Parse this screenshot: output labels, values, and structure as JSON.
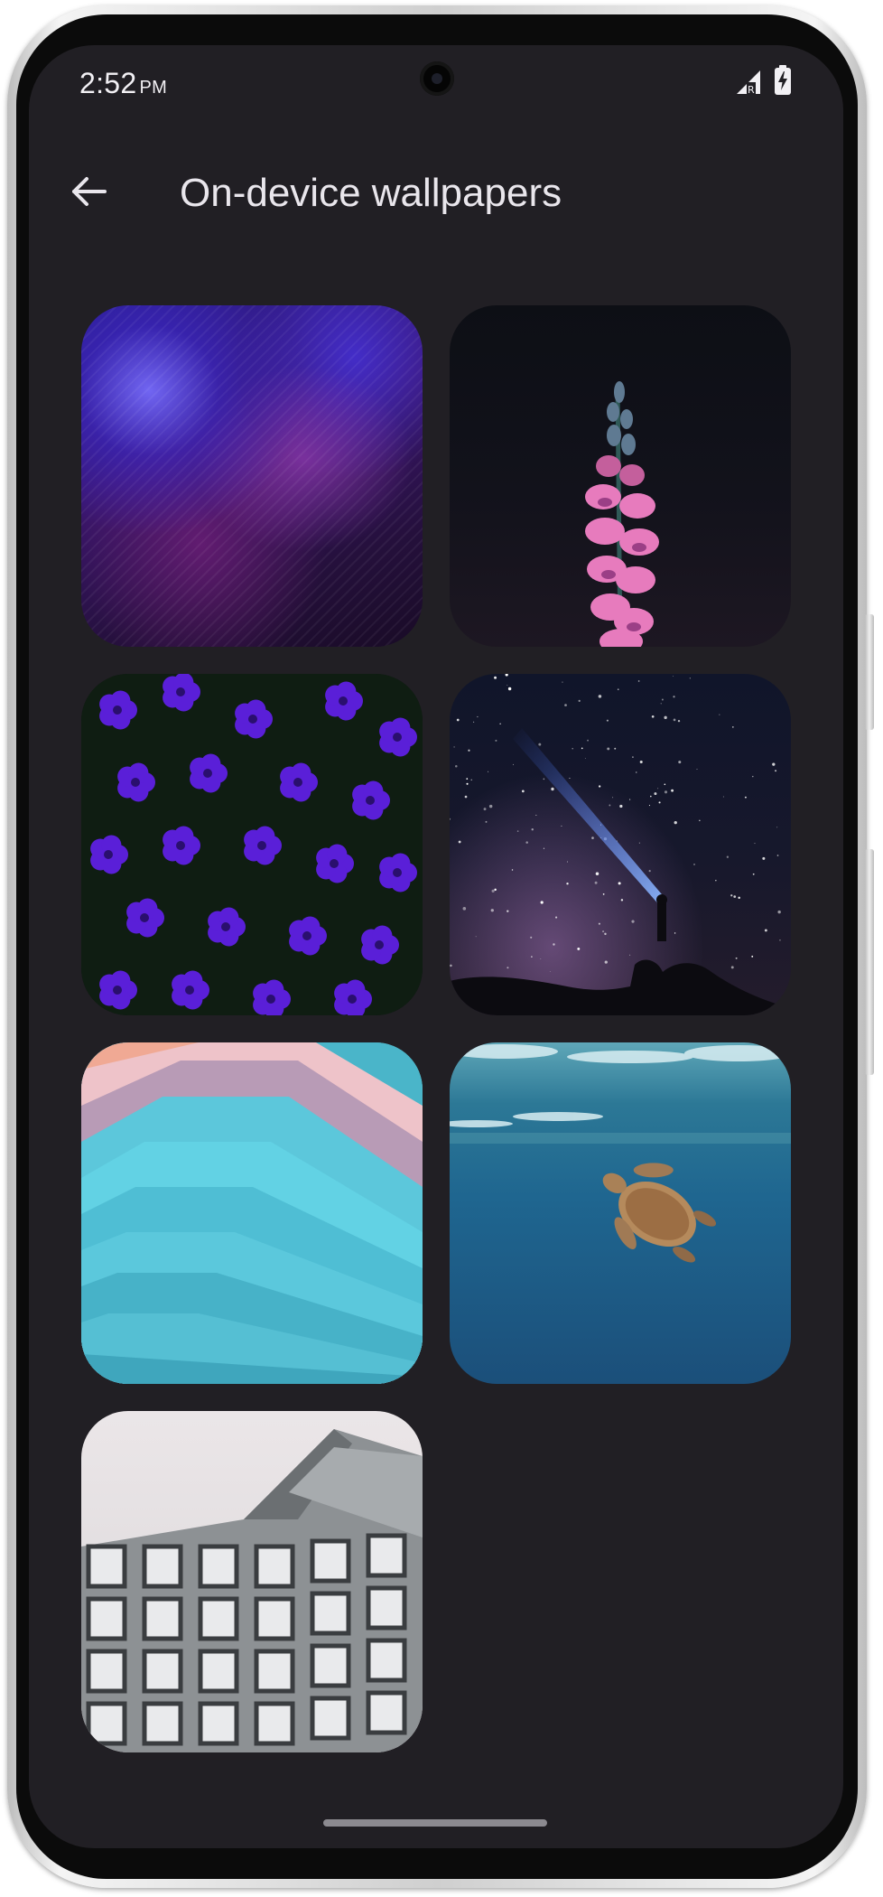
{
  "status_bar": {
    "time": "2:52",
    "ampm": "PM",
    "signal_icon": "signal-r-icon",
    "battery_icon": "battery-charging-icon"
  },
  "header": {
    "back_icon": "arrow-back-icon",
    "title": "On-device wallpapers"
  },
  "wallpapers": [
    {
      "name": "wallpaper-purple-paint"
    },
    {
      "name": "wallpaper-pink-flower"
    },
    {
      "name": "wallpaper-violet-flowers"
    },
    {
      "name": "wallpaper-starry-sky"
    },
    {
      "name": "wallpaper-layered-paper"
    },
    {
      "name": "wallpaper-sea-turtle"
    },
    {
      "name": "wallpaper-building"
    }
  ],
  "colors": {
    "background": "#211f24",
    "title_text": "#e9e6ec",
    "nav_handle": "#8c8a90"
  }
}
